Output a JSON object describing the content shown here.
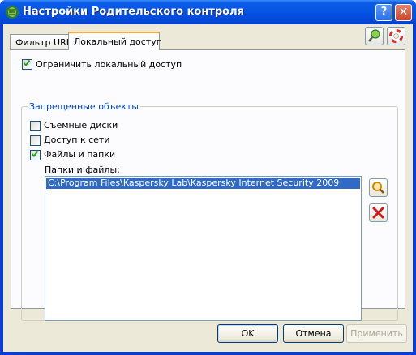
{
  "window": {
    "title": "Настройки Родительского контроля",
    "help_label": "?",
    "close_label": "✕"
  },
  "tabs": [
    {
      "label": "Фильтр URL",
      "selected": false
    },
    {
      "label": "Локальный доступ",
      "selected": true
    }
  ],
  "restrict": {
    "label": "Ограничить локальный доступ",
    "checked": true
  },
  "group": {
    "title": "Запрещенные объекты",
    "items": [
      {
        "label": "Съемные диски",
        "checked": false
      },
      {
        "label": "Доступ к сети",
        "checked": false
      },
      {
        "label": "Файлы и папки",
        "checked": true
      }
    ]
  },
  "list": {
    "label": "Папки и файлы:",
    "rows": [
      "C:\\Program Files\\Kaspersky Lab\\Kaspersky Internet Security 2009"
    ]
  },
  "buttons": {
    "ok": "OK",
    "cancel": "Отмена",
    "apply": "Применить"
  },
  "colors": {
    "selection": "#316ac5",
    "group_title": "#0046d5",
    "dialog_bg": "#ece9d8"
  }
}
